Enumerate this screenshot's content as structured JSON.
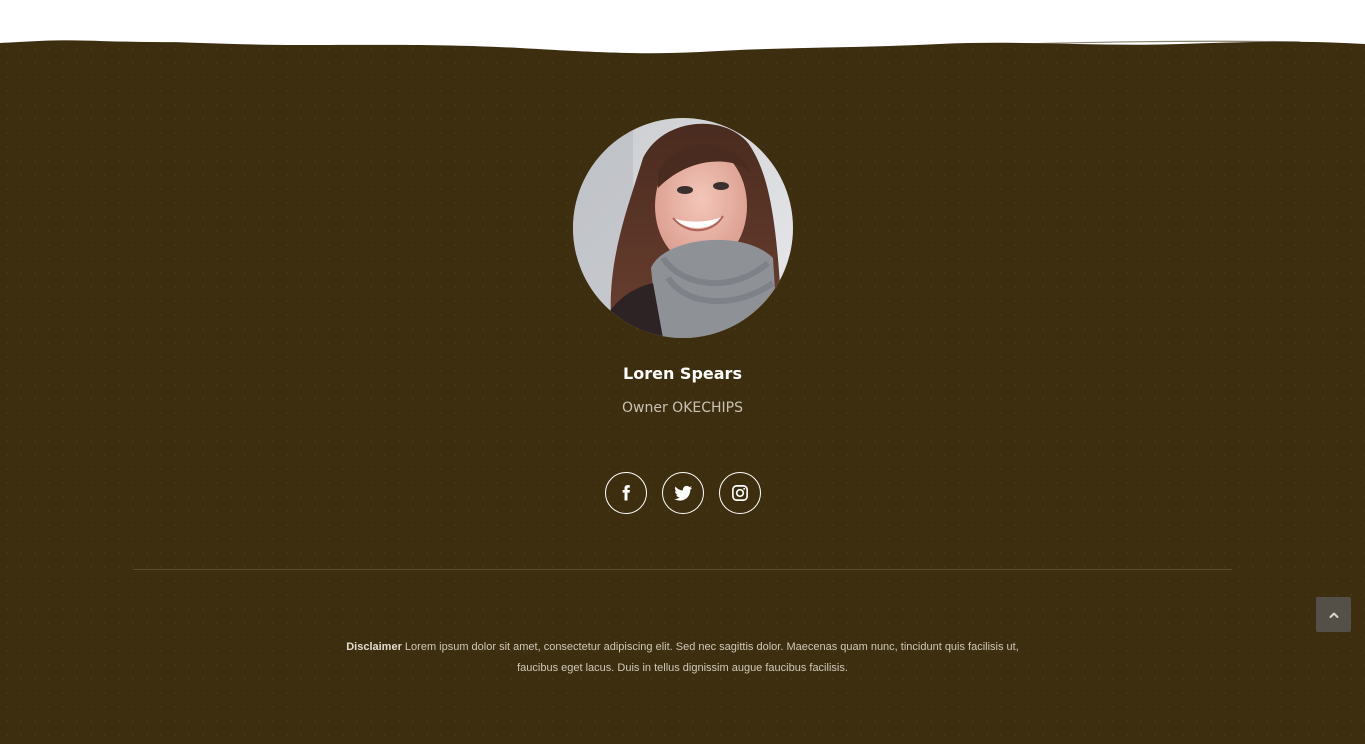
{
  "profile": {
    "name": "Loren Spears",
    "role": "Owner OKECHIPS",
    "avatar_icon": "portrait-photo"
  },
  "social": [
    {
      "name": "facebook",
      "icon": "facebook-icon"
    },
    {
      "name": "twitter",
      "icon": "twitter-icon"
    },
    {
      "name": "instagram",
      "icon": "instagram-icon"
    }
  ],
  "disclaimer": {
    "label": "Disclaimer",
    "text": "Lorem ipsum dolor sit amet, consectetur adipiscing elit. Sed nec sagittis dolor. Maecenas quam nunc, tincidunt quis facilisis ut, faucibus eget lacus. Duis in tellus dignissim augue faucibus facilisis."
  },
  "scroll_top": {
    "icon": "chevron-up-icon"
  },
  "colors": {
    "footer_bg": "#3d2e10",
    "text_light": "#ffffff",
    "text_muted": "#c9c2b4",
    "divider": "#5a4b2b",
    "scroll_button": "#555047"
  }
}
